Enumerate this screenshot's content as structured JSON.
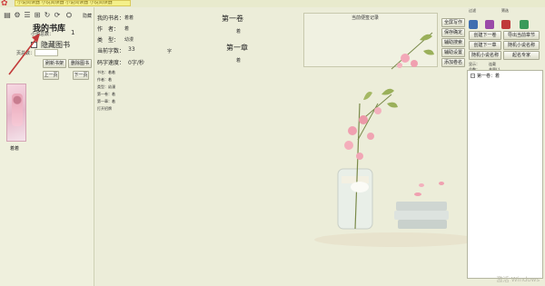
{
  "window": {
    "title": "小说阅读器 小说阅读器 小说阅读器 小说阅读器"
  },
  "toolbar": {
    "tools": [
      "书架",
      "设置",
      "目录",
      "书签",
      "刷新",
      "朗读"
    ],
    "hide_label": "隐藏"
  },
  "library": {
    "title": "我的书库",
    "count_label": "小说总数：",
    "count": "1",
    "hide_books_label": "隐藏图书",
    "page_label": "页总数：",
    "refresh_button": "刷新书架",
    "delete_button": "删除图书",
    "prev_button": "上一页",
    "next_button": "下一页",
    "book_name": "着着"
  },
  "book_info": {
    "name_label": "我的书名：",
    "name": "着着",
    "author_label": "作　者：",
    "author": "着",
    "type_label": "类　型：",
    "type": "幼漫",
    "chars_label": "当前字数：",
    "chars": "33",
    "chars_unit": "字",
    "speed_label": "码字速度：",
    "speed": "0字/秒"
  },
  "detail": {
    "line1": "书名：着着",
    "line2": "作者：着",
    "line3": "类型：幼漫",
    "line4": "第一卷：着",
    "line5": "第一章：着",
    "line6": "打开招牌"
  },
  "reader": {
    "volume_title": "第一卷",
    "volume_sub": "着",
    "chapter_title": "第一章",
    "chapter_sub": "着"
  },
  "notes": {
    "title": "当前便签记录"
  },
  "actions": {
    "fullscreen": "全屏写作",
    "save_confirm": "保存确定",
    "assist_search": "辅助搜索",
    "assist_setup": "辅助设置",
    "add_volume": "添加卷名",
    "add_next_chapter_a": "创建下一卷",
    "add_next_chapter_b": "创建下一章",
    "random_name_a": "随机小说名称",
    "volume_hint": "导出当前章节",
    "name_suggest": "起名专家",
    "filter": "过滤",
    "fuse": "筛选",
    "tree_label_a": "显示：",
    "tree_label_b": "连载",
    "tree_label_c": "总数：",
    "tree_label_d": "共量(:)"
  },
  "tree": {
    "item": "第一卷：着"
  },
  "watermark": "激活 Windows",
  "colors": {
    "background": "#ecedd9",
    "accent": "#d04040",
    "title_highlight": "#f4f08a"
  }
}
